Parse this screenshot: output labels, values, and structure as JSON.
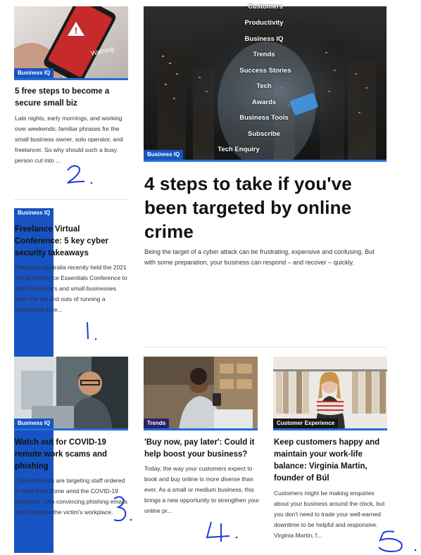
{
  "articles": [
    {
      "category": "Business IQ",
      "title": "5 free steps to become a secure small biz",
      "excerpt": "Late nights, early mornings, and working over weekends; familiar phrases for the small business owner, solo operator, and freelancer. So why should such a busy person cut into ..."
    },
    {
      "category": "Business IQ",
      "title": "Freelance Virtual Conference: 5 key cyber security takeaways",
      "excerpt": "Freelance Australia recently held the 2021 virtual Freelance Essentials Conference to help freelancers and small businesses learn the ins and outs of running a freelancing ente..."
    },
    {
      "category": "Business IQ",
      "title": "Watch out for COVID-19 remote work scams and phishing",
      "excerpt": "Cybercriminals are targeting staff ordered to work from home amid the COVID-19 pandemic, with convincing phishing emails that reference the victim's workplace."
    },
    {
      "category": "Trends",
      "title": "'Buy now, pay later': Could it help boost your business?",
      "excerpt": "Today, the way your customers expect to book and buy online is more diverse than ever. As a small or medium business, this brings a new opportunity to strengthen your online pr..."
    },
    {
      "category": "Customer Experience",
      "title": "Keep customers happy and maintain your work-life balance: Virginia Martin, founder of Búl",
      "excerpt": "Customers might be making enquiries about your business around the clock, but you don't need to trade your well-earned downtime to be helpful and responsive. Virginia Martin, f..."
    }
  ],
  "featured": {
    "category": "Business IQ",
    "title": "4 steps to take if you've been targeted by online crime",
    "excerpt": "Being the target of a cyber attack can be frustrating, expensive and confusing. But with some preparation, your business can respond – and recover – quickly."
  },
  "warning_image_text": "Warning",
  "menu_overlay": [
    "Customers",
    "Productivity",
    "Business IQ",
    "Trends",
    "Success Stories",
    "Tech",
    "Awards",
    "Business Tools",
    "Subscribe",
    "Tech Enquiry"
  ],
  "handwritten_numbers": [
    "2",
    "1",
    "3",
    "4",
    "5"
  ],
  "colors": {
    "accent_blue": "#1f6fd6",
    "tag_blue": "#1753c2",
    "tag_dark": "#141414",
    "tag_purple": "#2b2266",
    "ink_annotation": "#1a3ad8"
  }
}
